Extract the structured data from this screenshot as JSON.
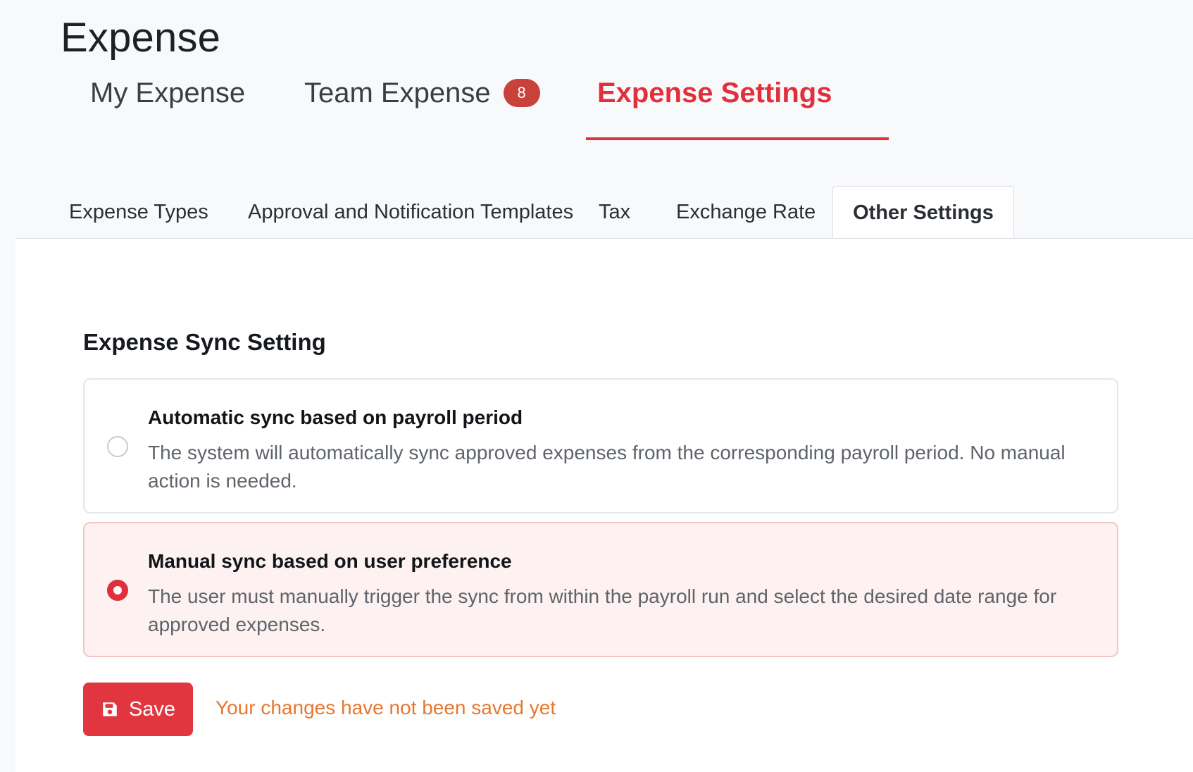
{
  "page": {
    "title": "Expense"
  },
  "main_tabs": [
    {
      "label": "My Expense",
      "active": false
    },
    {
      "label": "Team Expense",
      "active": false,
      "badge": "8"
    },
    {
      "label": "Expense Settings",
      "active": true
    }
  ],
  "sub_tabs": [
    {
      "label": "Expense Types",
      "active": false
    },
    {
      "label": "Approval and Notification Templates",
      "active": false
    },
    {
      "label": "Tax",
      "active": false
    },
    {
      "label": "Exchange Rate",
      "active": false
    },
    {
      "label": "Other Settings",
      "active": true
    }
  ],
  "sync_setting": {
    "title": "Expense Sync Setting",
    "options": [
      {
        "title": "Automatic sync based on payroll period",
        "description": "The system will automatically sync approved expenses from the corresponding payroll period. No manual action is needed.",
        "selected": false
      },
      {
        "title": "Manual sync based on user preference",
        "description": "The user must manually trigger the sync from within the payroll run and select the desired date range for approved expenses.",
        "selected": true
      }
    ]
  },
  "footer": {
    "save_label": "Save",
    "save_icon": "floppy-disk-icon",
    "unsaved_message": "Your changes have not been saved yet"
  },
  "colors": {
    "accent": "#e1303c",
    "badge": "#c8413a",
    "warning_text": "#e8772e",
    "selected_card_bg": "#fdf1f1"
  }
}
